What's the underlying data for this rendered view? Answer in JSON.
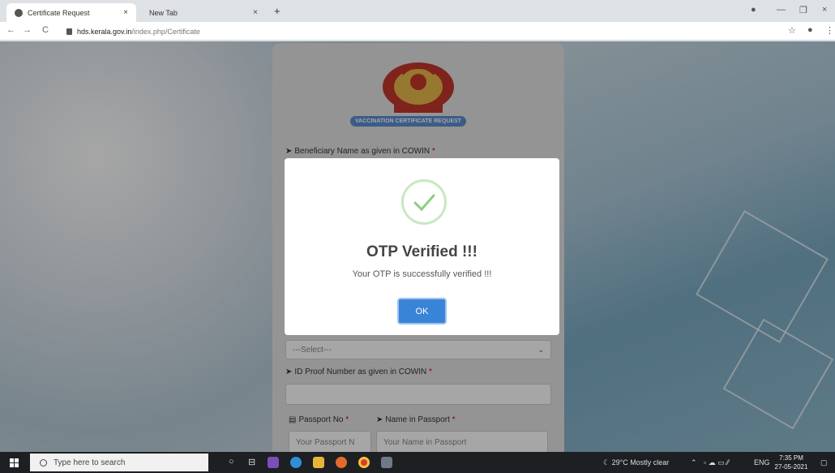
{
  "browser": {
    "tabs": [
      {
        "label": "Certificate Request",
        "close": "×"
      },
      {
        "label": "New Tab",
        "close": "×"
      }
    ],
    "new_tab": "+",
    "url_host": "hds.kerala.gov.in",
    "url_path": "/index.php/Certificate",
    "nav": {
      "back": "←",
      "forward": "→",
      "reload": "C"
    },
    "window": {
      "minimize": "—",
      "maximize": "❐",
      "close": "×"
    }
  },
  "form": {
    "badge": "VACCINATION CERTIFICATE REQUEST",
    "beneficiary_label": "Beneficiary Name as given in COWIN",
    "required_mark": "*",
    "select_value": "---Select---",
    "id_proof_label": "ID Proof Number as given in COWIN",
    "passport_no_label": "Passport No",
    "passport_name_label": "Name in Passport",
    "passport_no_placeholder": "Your Passport N",
    "passport_name_placeholder": "Your Name in Passport"
  },
  "dialog": {
    "title": "OTP Verified !!!",
    "message": "Your OTP is successfully verified !!!",
    "ok_label": "OK"
  },
  "taskbar": {
    "search_placeholder": "Type here to search",
    "weather": "29°C  Mostly clear",
    "language": "ENG",
    "time": "7:35 PM",
    "date": "27-05-2021"
  }
}
